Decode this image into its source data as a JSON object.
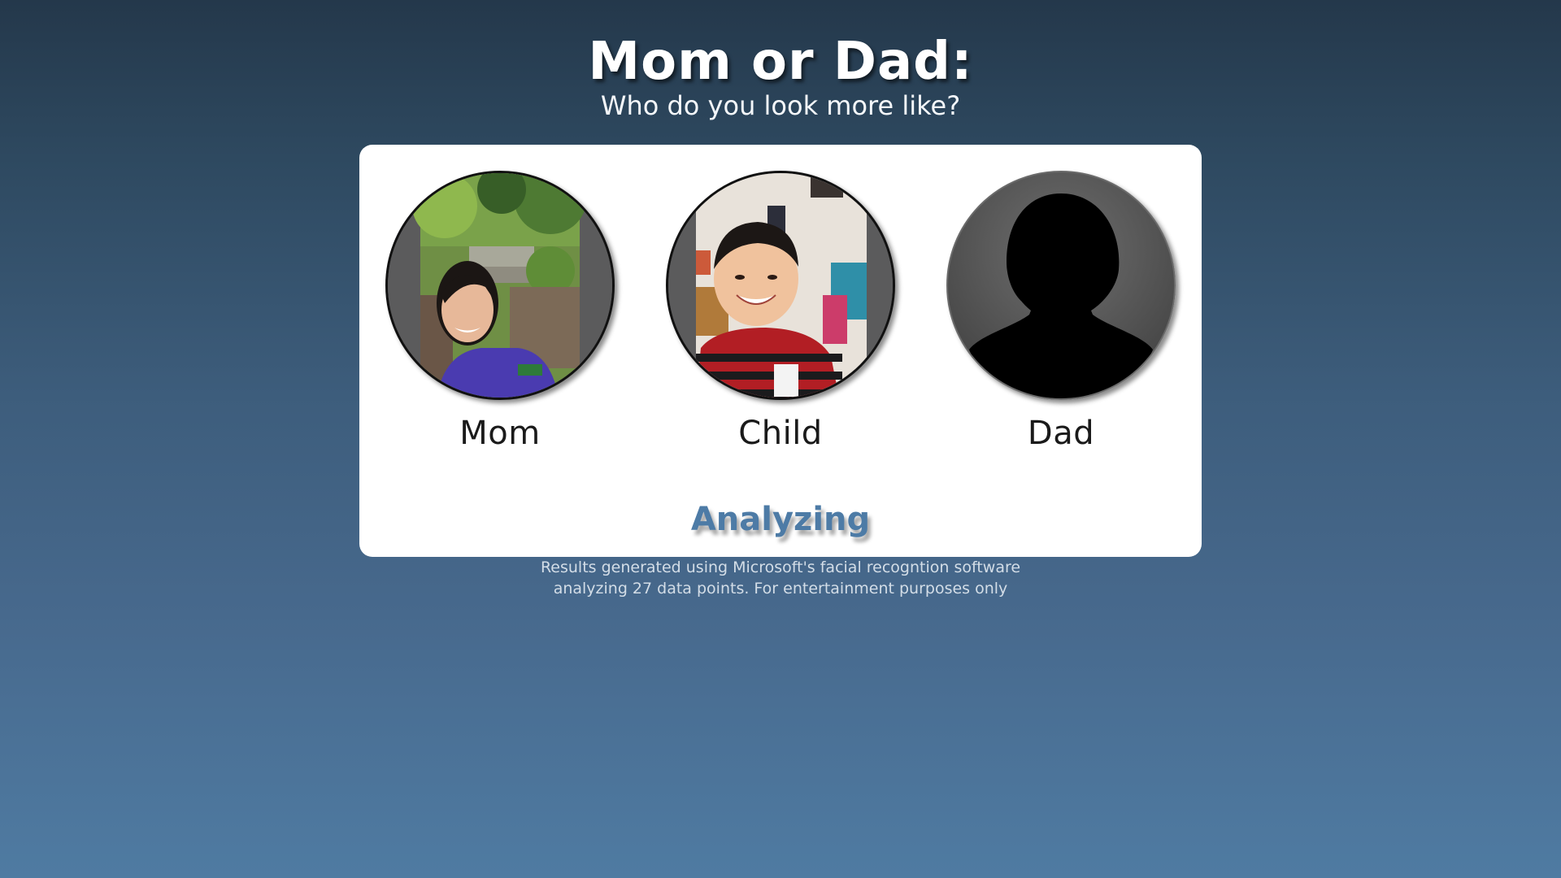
{
  "header": {
    "title": "Mom or Dad:",
    "subtitle": "Who do you look more like?"
  },
  "people": [
    {
      "label": "Mom",
      "photo": "mom-photo"
    },
    {
      "label": "Child",
      "photo": "child-photo"
    },
    {
      "label": "Dad",
      "photo": "silhouette-placeholder-icon"
    }
  ],
  "status": "Analyzing",
  "disclaimer": {
    "line1": "Results generated using Microsoft's facial recogntion software",
    "line2": "analyzing 27 data points. For entertainment purposes only"
  },
  "colors": {
    "status_text": "#4d7ba6",
    "background_top": "#24384b",
    "background_bottom": "#4f7ba2"
  }
}
